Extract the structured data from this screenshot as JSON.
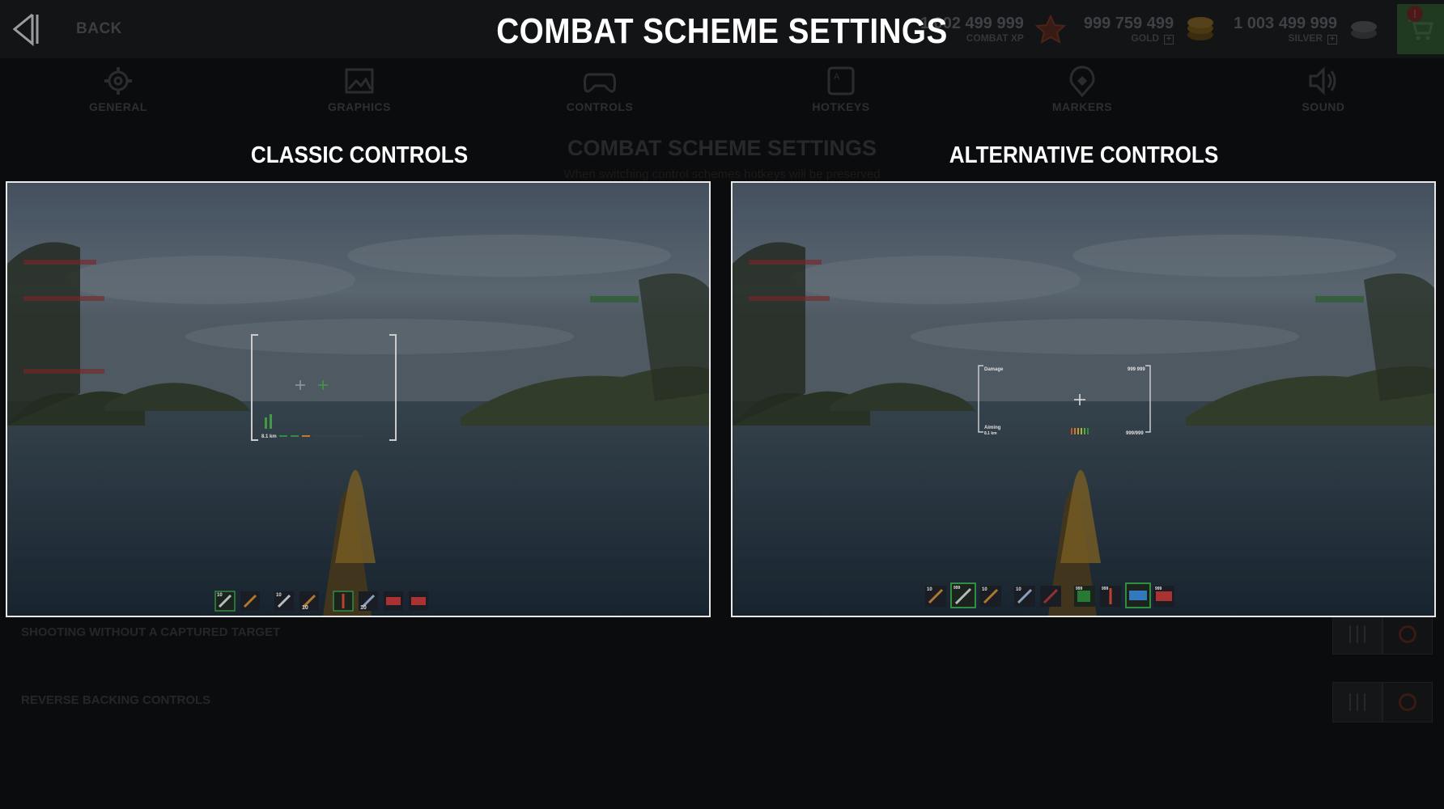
{
  "header": {
    "back_label": "BACK",
    "title": "COMBAT SCHEME SETTINGS",
    "currencies": [
      {
        "value": "1 002 499 999",
        "label": "COMBAT XP",
        "icon": "combat-xp-icon",
        "plus": false
      },
      {
        "value": "999 759 499",
        "label": "GOLD",
        "icon": "gold-coins-icon",
        "plus": true
      },
      {
        "value": "1 003 499 999",
        "label": "SILVER",
        "icon": "silver-coins-icon",
        "plus": true
      }
    ],
    "cart_badge": "!"
  },
  "tabs": [
    {
      "label": "GENERAL",
      "icon": "gear-icon"
    },
    {
      "label": "GRAPHICS",
      "icon": "picture-icon"
    },
    {
      "label": "CONTROLS",
      "icon": "gamepad-icon"
    },
    {
      "label": "HOTKEYS",
      "icon": "key-icon"
    },
    {
      "label": "MARKERS",
      "icon": "marker-icon"
    },
    {
      "label": "SOUND",
      "icon": "speaker-icon"
    }
  ],
  "section": {
    "title": "COMBAT SCHEME SETTINGS",
    "subtitle": "When switching control schemes hotkeys will be preserved"
  },
  "settings": [
    {
      "label": "SHOOTING WITHOUT A CAPTURED TARGET"
    },
    {
      "label": "REVERSE BACKING CONTROLS"
    }
  ],
  "panels": {
    "classic": {
      "title": "CLASSIC CONTROLS",
      "hud": {
        "range": "8.1 km",
        "ammo_a": "10",
        "ammo_b": "10",
        "ammo_c": "10",
        "ammo_d": "10"
      }
    },
    "alternative": {
      "title": "ALTERNATIVE CONTROLS",
      "hud": {
        "damage_label": "Damage",
        "damage_value": "999 999",
        "aiming_label": "Aiming",
        "aiming_range": "8.1 km",
        "count_value": "999/999",
        "ammo_a": "10",
        "ammo_b": "999",
        "ammo_c": "10",
        "ammo_d": "10",
        "ammo_e": "999",
        "ammo_f": "999",
        "ammo_g": "999"
      }
    }
  },
  "colors": {
    "background": "#0b0c0d",
    "accent_green": "#2f9a3a",
    "panel_border": "#e8e8e8"
  }
}
